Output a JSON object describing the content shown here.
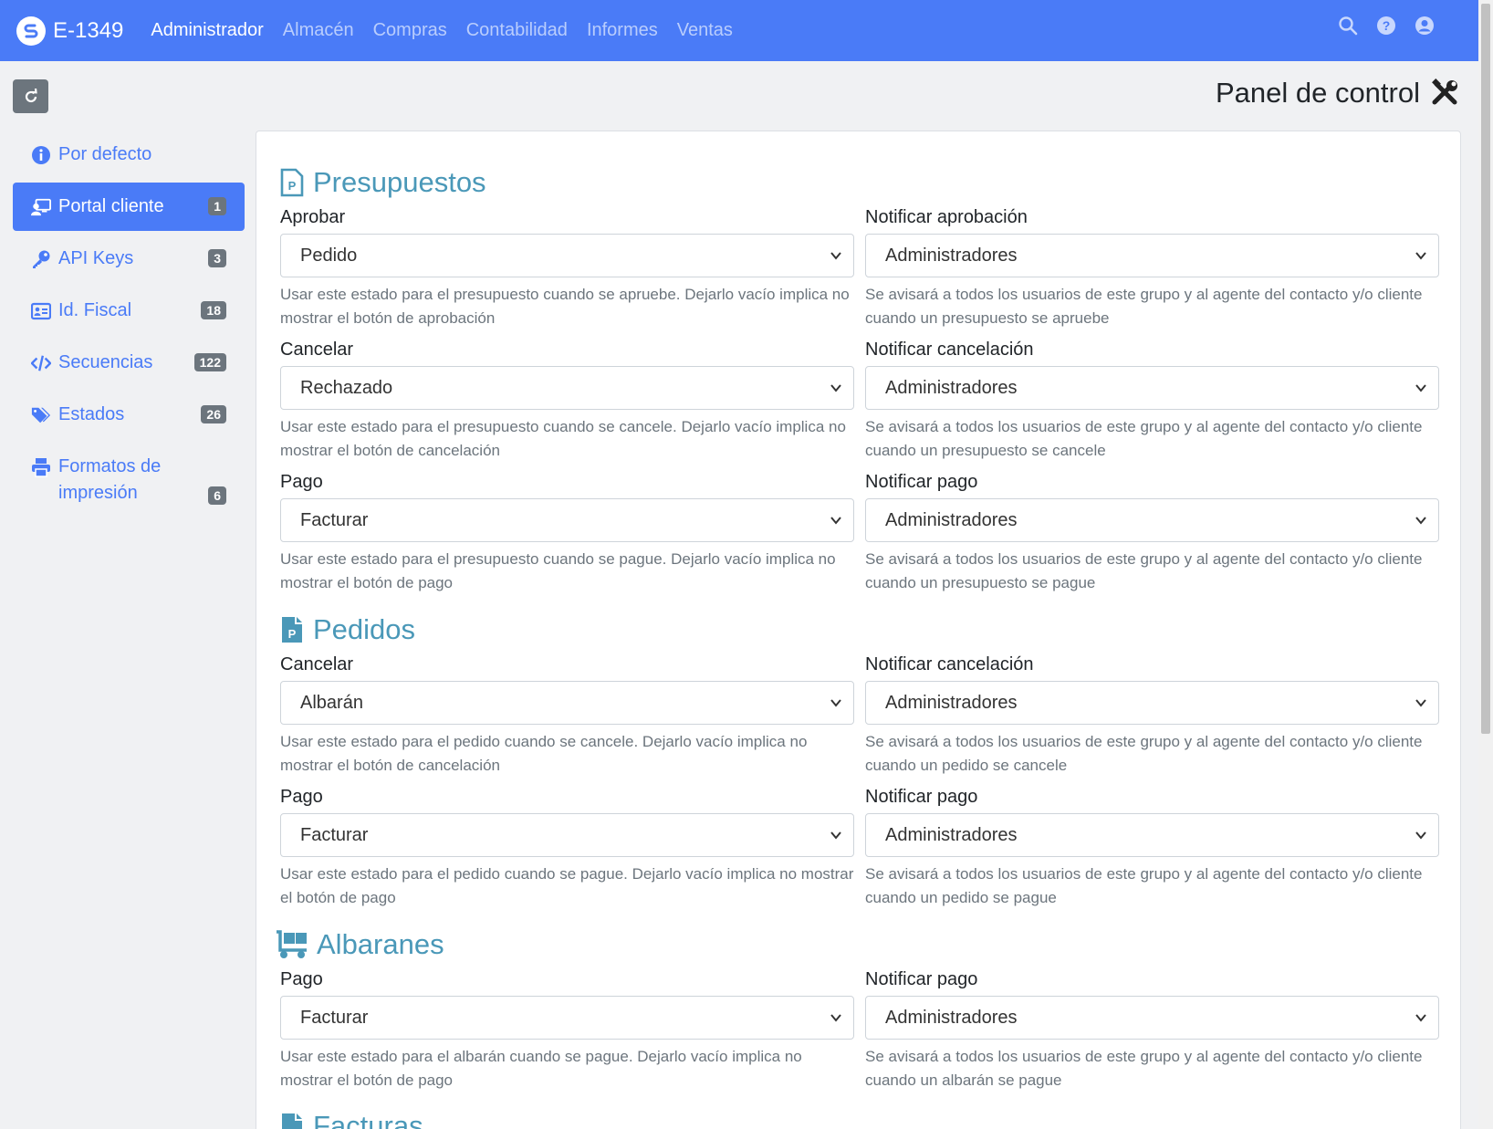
{
  "header": {
    "brand": "E-1349",
    "nav": [
      "Administrador",
      "Almacén",
      "Compras",
      "Contabilidad",
      "Informes",
      "Ventas"
    ],
    "active_nav": "Administrador",
    "icons": [
      "search-icon",
      "help-icon",
      "user-icon"
    ]
  },
  "page": {
    "title": "Panel de control"
  },
  "sidebar": {
    "items": [
      {
        "label": "Por defecto",
        "icon": "info-icon",
        "badge": ""
      },
      {
        "label": "Portal cliente",
        "icon": "portal-icon",
        "badge": "1",
        "active": true
      },
      {
        "label": "API Keys",
        "icon": "key-icon",
        "badge": "3"
      },
      {
        "label": "Id. Fiscal",
        "icon": "id-card-icon",
        "badge": "18"
      },
      {
        "label": "Secuencias",
        "icon": "code-icon",
        "badge": "122"
      },
      {
        "label": "Estados",
        "icon": "tags-icon",
        "badge": "26"
      },
      {
        "label": "Formatos de impresión",
        "icon": "print-icon",
        "badge": "6"
      }
    ]
  },
  "sections": {
    "presupuestos": {
      "title": "Presupuestos",
      "aprobar": {
        "label": "Aprobar",
        "value": "Pedido",
        "help": "Usar este estado para el presupuesto cuando se apruebe. Dejarlo vacío implica no mostrar el botón de aprobación"
      },
      "notificar_aprobacion": {
        "label": "Notificar aprobación",
        "value": "Administradores",
        "help": "Se avisará a todos los usuarios de este grupo y al agente del contacto y/o cliente cuando un presupuesto se apruebe"
      },
      "cancelar": {
        "label": "Cancelar",
        "value": "Rechazado",
        "help": "Usar este estado para el presupuesto cuando se cancele. Dejarlo vacío implica no mostrar el botón de cancelación"
      },
      "notificar_cancelacion": {
        "label": "Notificar cancelación",
        "value": "Administradores",
        "help": "Se avisará a todos los usuarios de este grupo y al agente del contacto y/o cliente cuando un presupuesto se cancele"
      },
      "pago": {
        "label": "Pago",
        "value": "Facturar",
        "help": "Usar este estado para el presupuesto cuando se pague. Dejarlo vacío implica no mostrar el botón de pago"
      },
      "notificar_pago": {
        "label": "Notificar pago",
        "value": "Administradores",
        "help": "Se avisará a todos los usuarios de este grupo y al agente del contacto y/o cliente cuando un presupuesto se pague"
      }
    },
    "pedidos": {
      "title": "Pedidos",
      "cancelar": {
        "label": "Cancelar",
        "value": "Albarán",
        "help": "Usar este estado para el pedido cuando se cancele. Dejarlo vacío implica no mostrar el botón de cancelación"
      },
      "notificar_cancelacion": {
        "label": "Notificar cancelación",
        "value": "Administradores",
        "help": "Se avisará a todos los usuarios de este grupo y al agente del contacto y/o cliente cuando un pedido se cancele"
      },
      "pago": {
        "label": "Pago",
        "value": "Facturar",
        "help": "Usar este estado para el pedido cuando se pague. Dejarlo vacío implica no mostrar el botón de pago"
      },
      "notificar_pago": {
        "label": "Notificar pago",
        "value": "Administradores",
        "help": "Se avisará a todos los usuarios de este grupo y al agente del contacto y/o cliente cuando un pedido se pague"
      }
    },
    "albaranes": {
      "title": "Albaranes",
      "pago": {
        "label": "Pago",
        "value": "Facturar",
        "help": "Usar este estado para el albarán cuando se pague. Dejarlo vacío implica no mostrar el botón de pago"
      },
      "notificar_pago": {
        "label": "Notificar pago",
        "value": "Administradores",
        "help": "Se avisará a todos los usuarios de este grupo y al agente del contacto y/o cliente cuando un albarán se pague"
      }
    },
    "facturas": {
      "title": "Facturas"
    }
  }
}
